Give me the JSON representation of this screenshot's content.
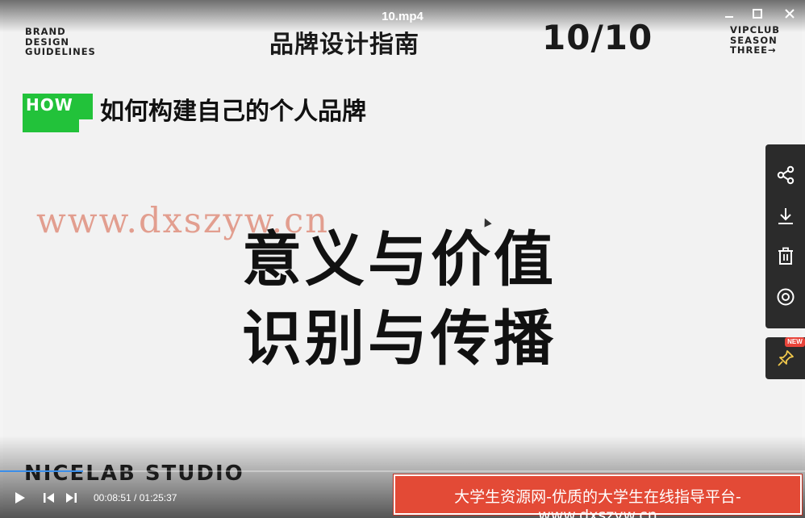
{
  "window": {
    "title": "10.mp4",
    "minimize_icon": "minimize-icon",
    "maximize_icon": "maximize-icon",
    "close_icon": "close-icon"
  },
  "slide": {
    "brand_left": [
      "BRAND",
      "DESIGN",
      "GUIDELINES"
    ],
    "title": "品牌设计指南",
    "page_number": "10/10",
    "brand_right": [
      "VIPCLUB",
      "SEASON",
      "THREE→"
    ],
    "how_label": "HOW",
    "how_title": "如何构建自己的个人品牌",
    "watermark": "www.dxszyw.cn",
    "main_lines": [
      "意义与价值",
      "识别与传播"
    ],
    "studio": "NICELAB STUDIO"
  },
  "side_toolbar": {
    "items": [
      "share-icon",
      "download-icon",
      "delete-icon",
      "view-icon"
    ],
    "pin_icon": "pin-icon",
    "pin_badge": "NEW"
  },
  "player": {
    "current_time": "00:08:51",
    "separator": " / ",
    "total_time": "01:25:37",
    "progress_fraction": 0.1034,
    "accent_color": "#3a8eea",
    "controls": [
      "play-icon",
      "previous-icon",
      "next-icon"
    ]
  },
  "ad_banner": {
    "text": "大学生资源网-优质的大学生在线指导平台-www.dxszyw.cn",
    "color": "#e34a36"
  }
}
